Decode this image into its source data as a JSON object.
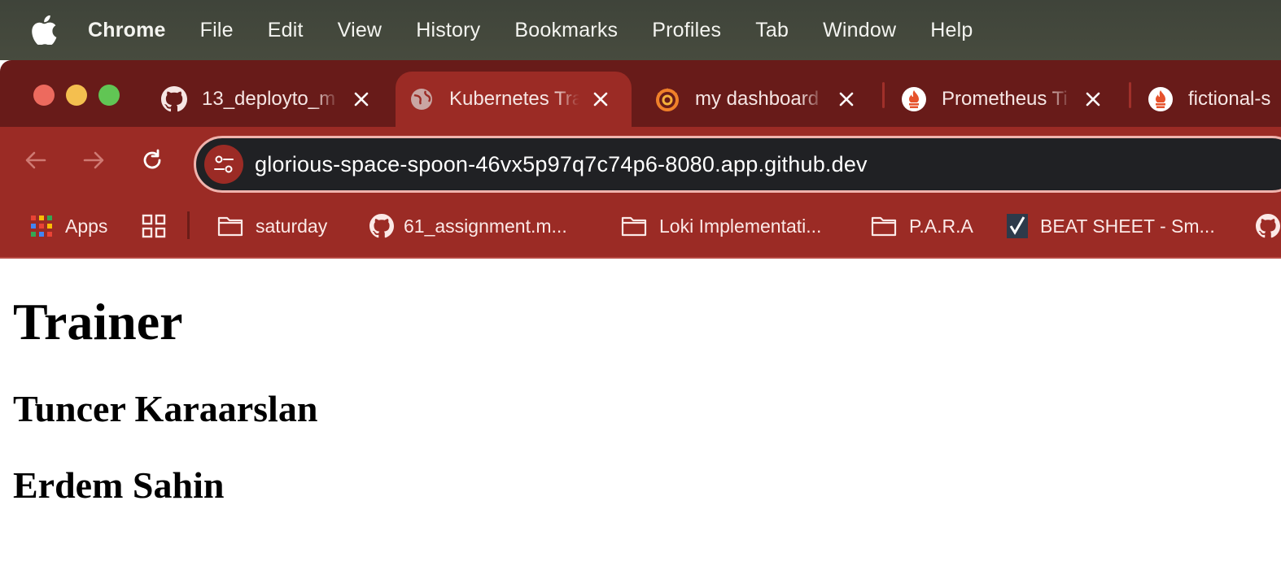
{
  "menubar": {
    "apple_icon": "apple-logo-icon",
    "items": [
      "Chrome",
      "File",
      "Edit",
      "View",
      "History",
      "Bookmarks",
      "Profiles",
      "Tab",
      "Window",
      "Help"
    ]
  },
  "tabs": [
    {
      "title": "13_deployto_m",
      "icon": "github-icon",
      "active": false
    },
    {
      "title": "Kubernetes Tra",
      "icon": "globe-icon",
      "active": true
    },
    {
      "title": "my dashboard",
      "icon": "grafana-icon",
      "active": false
    },
    {
      "title": "Prometheus Ti",
      "icon": "prometheus-icon",
      "active": false
    },
    {
      "title": "fictional-s",
      "icon": "prometheus-icon",
      "active": false
    }
  ],
  "toolbar": {
    "url": "glorious-space-spoon-46vx5p97q7c74p6-8080.app.github.dev"
  },
  "bookmarks": [
    {
      "label": "Apps",
      "icon": "apps-grid-icon"
    },
    {
      "label": "",
      "icon": "tab-groups-icon"
    },
    {
      "label": "saturday",
      "icon": "folder-icon"
    },
    {
      "label": "61_assignment.m...",
      "icon": "github-icon"
    },
    {
      "label": "Loki Implementati...",
      "icon": "folder-icon"
    },
    {
      "label": "P.A.R.A",
      "icon": "folder-icon"
    },
    {
      "label": "BEAT SHEET - Sm...",
      "icon": "checkmark-favicon-icon"
    },
    {
      "label": "",
      "icon": "github-icon"
    }
  ],
  "page": {
    "heading": "Trainer",
    "trainers": [
      "Tuncer Karaarslan",
      "Erdem Sahin"
    ]
  },
  "colors": {
    "menubar": "#43473c",
    "tabstrip": "#681b19",
    "toolbar": "#9b2b25",
    "omnibox": "#202124",
    "omnibox_border": "#f0b3ad"
  }
}
